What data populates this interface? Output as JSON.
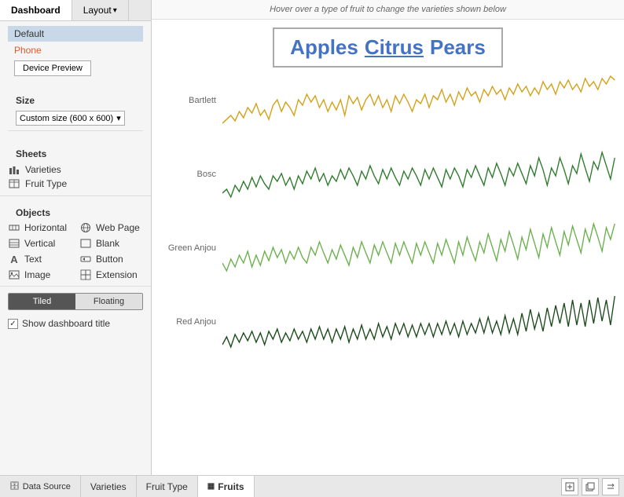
{
  "tabs": {
    "dashboard_label": "Dashboard",
    "layout_label": "Layout"
  },
  "sidebar": {
    "default_label": "Default",
    "phone_label": "Phone",
    "device_preview_btn": "Device Preview",
    "size_section_title": "Size",
    "size_value": "Custom size (600 x 600)",
    "sheets_title": "Sheets",
    "sheets": [
      {
        "id": "varieties",
        "label": "Varieties"
      },
      {
        "id": "fruit-type",
        "label": "Fruit Type"
      }
    ],
    "objects_title": "Objects",
    "objects": [
      {
        "id": "horizontal",
        "label": "Horizontal",
        "col": 0
      },
      {
        "id": "webpage",
        "label": "Web Page",
        "col": 1
      },
      {
        "id": "vertical",
        "label": "Vertical",
        "col": 0
      },
      {
        "id": "blank",
        "label": "Blank",
        "col": 1
      },
      {
        "id": "text",
        "label": "Text",
        "col": 0
      },
      {
        "id": "button",
        "label": "Button",
        "col": 1
      },
      {
        "id": "image",
        "label": "Image",
        "col": 0
      },
      {
        "id": "extension",
        "label": "Extension",
        "col": 1
      }
    ],
    "tiled_label": "Tiled",
    "floating_label": "Floating",
    "show_title_label": "Show dashboard title"
  },
  "chart": {
    "hover_hint": "Hover over a type of fruit to change the varieties shown below",
    "fruit_title": {
      "apples": "Apples",
      "citrus": "Citrus",
      "pears": "Pears"
    },
    "rows": [
      {
        "label": "Bartlett",
        "color": "#d4a017"
      },
      {
        "label": "Bosc",
        "color": "#2d7a2d"
      },
      {
        "label": "Green Anjou",
        "color": "#6ab04c"
      },
      {
        "label": "Red Anjou",
        "color": "#1a4a1a"
      }
    ]
  },
  "bottom_bar": {
    "datasource_label": "Data Source",
    "tabs": [
      {
        "id": "varieties",
        "label": "Varieties",
        "active": false
      },
      {
        "id": "fruit-type",
        "label": "Fruit Type",
        "active": false
      },
      {
        "id": "fruits",
        "label": "Fruits",
        "active": true
      }
    ]
  }
}
